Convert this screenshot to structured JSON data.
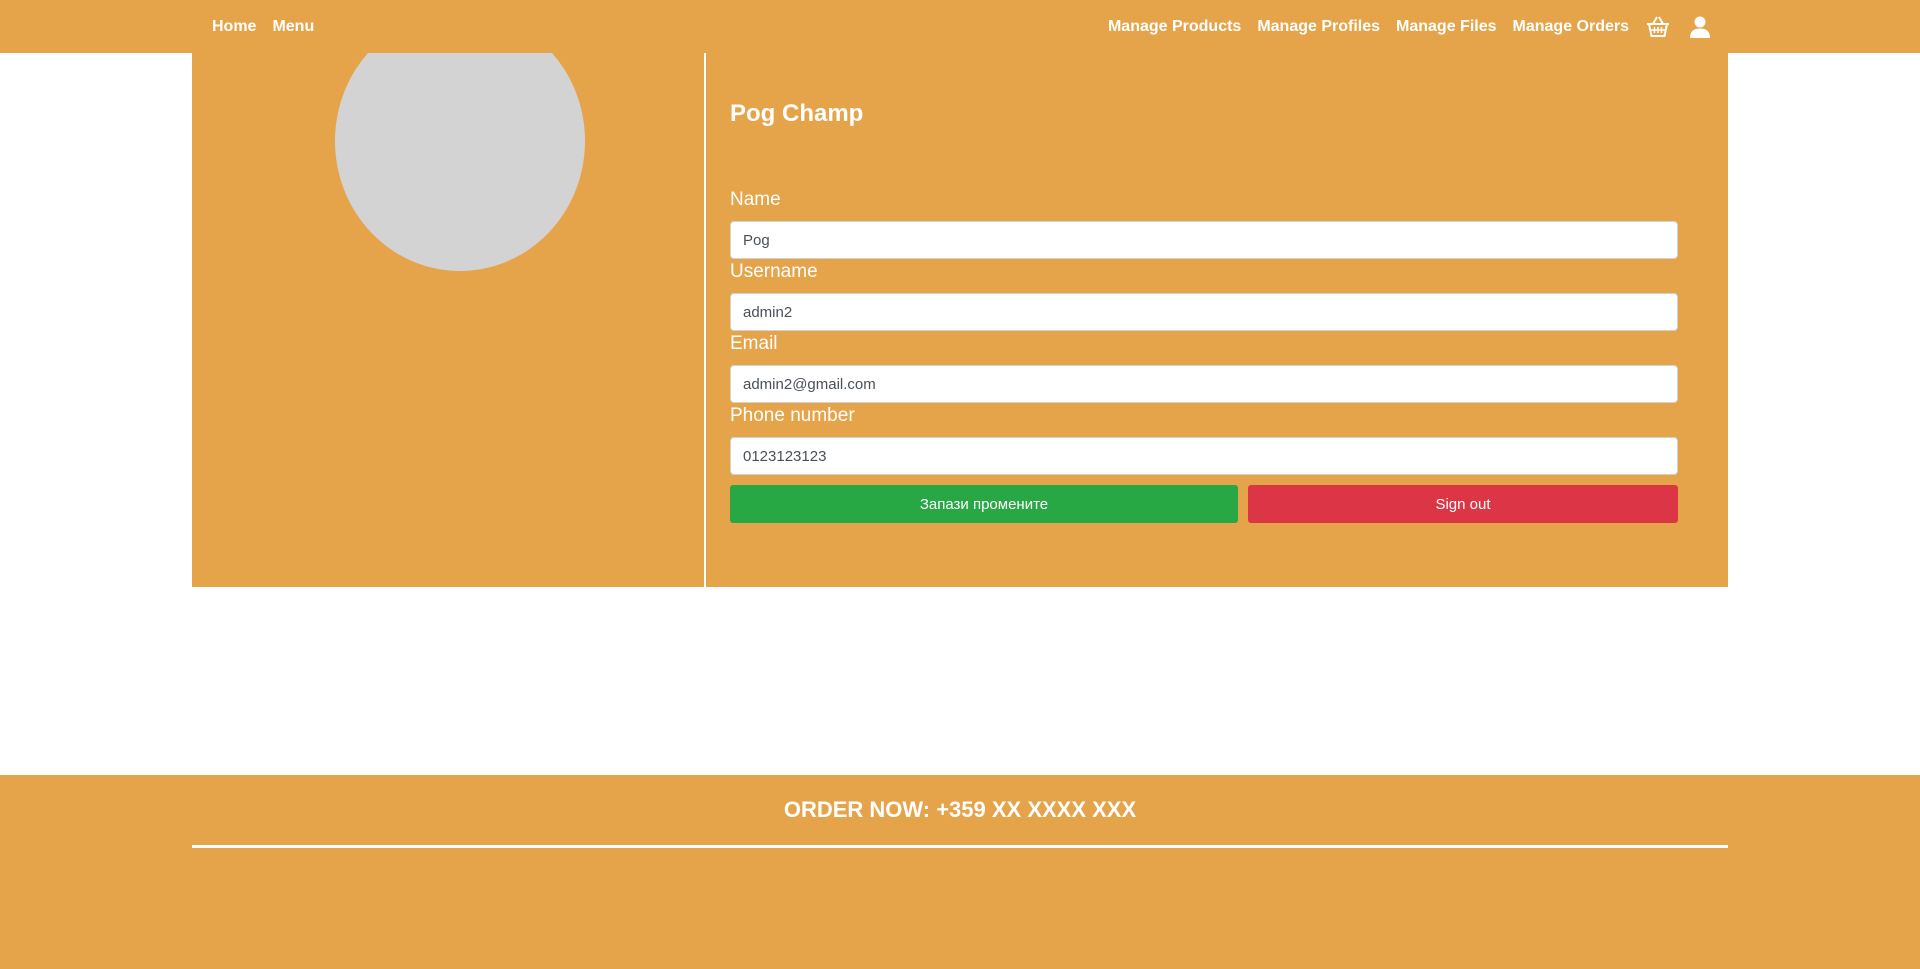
{
  "nav": {
    "left_links": [
      "Home",
      "Menu"
    ],
    "right_links": [
      "Manage Products",
      "Manage Profiles",
      "Manage Files",
      "Manage Orders"
    ],
    "icons": [
      "basket-icon",
      "user-icon"
    ]
  },
  "profile": {
    "display_name": "Pog Champ",
    "fields": {
      "name": {
        "label": "Name",
        "value": "Pog"
      },
      "username": {
        "label": "Username",
        "value": "admin2"
      },
      "email": {
        "label": "Email",
        "value": "admin2@gmail.com"
      },
      "phone": {
        "label": "Phone number",
        "value": "0123123123"
      }
    },
    "save_label": "Запази промените",
    "signout_label": "Sign out"
  },
  "footer": {
    "order_text": "ORDER NOW: +359 XX XXXX XXX"
  },
  "colors": {
    "brand": "#e6a44a",
    "save": "#28a745",
    "signout": "#dc3545",
    "avatar": "#d3d3d3"
  }
}
